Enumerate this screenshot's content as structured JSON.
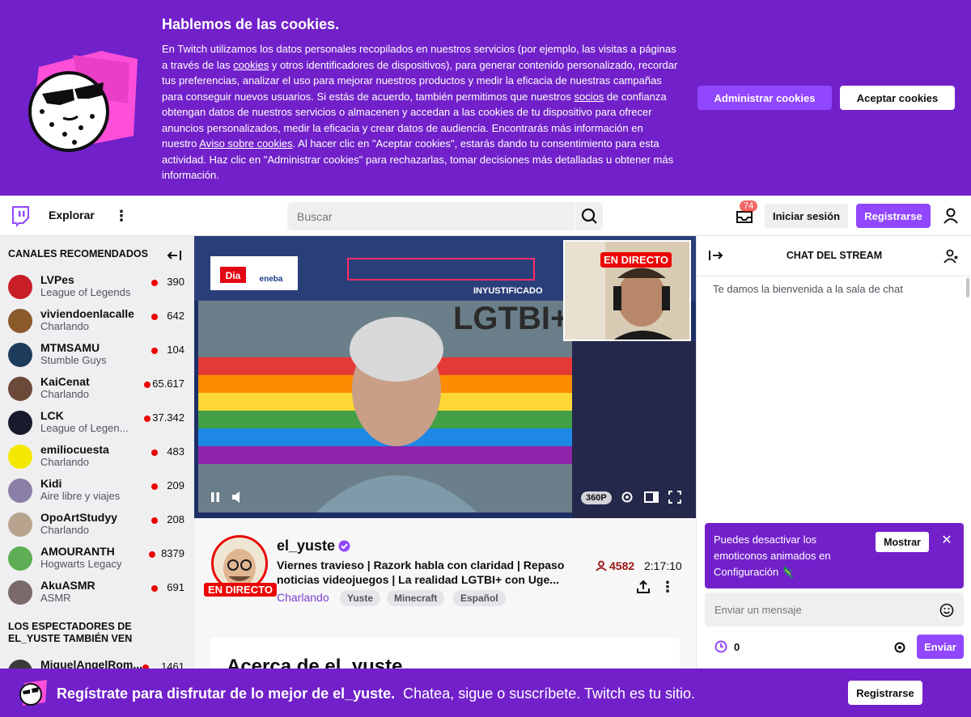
{
  "cookies": {
    "title": "Hablemos de las cookies.",
    "body_1": "En Twitch utilizamos los datos personales recopilados en nuestros servicios (por ejemplo, las visitas a páginas a través de las ",
    "link_cookies": "cookies",
    "body_2": " y otros identificadores de dispositivos), para generar contenido personalizado, recordar tus preferencias, analizar el uso para mejorar nuestros productos y medir la eficacia de nuestras campañas para conseguir nuevos usuarios.   Si estás de acuerdo, también permitimos que nuestros ",
    "link_socios": "socios",
    "body_3": " de confianza obtengan datos de nuestros servicios o almacenen y accedan a las cookies de tu dispositivo para ofrecer anuncios personalizados, medir la eficacia y crear datos de audiencia. Encontrarás más información en nuestro ",
    "link_aviso": "Aviso sobre cookies",
    "body_4": ". Al hacer clic en \"Aceptar cookies\", estarás dando tu consentimiento para esta actividad. Haz clic en \"Administrar cookies\" para rechazarlas, tomar decisiones más detalladas u obtener más información.",
    "manage_label": "Administrar cookies",
    "accept_label": "Aceptar cookies"
  },
  "nav": {
    "explore": "Explorar",
    "more": "⋮",
    "search_placeholder": "Buscar",
    "inbox_badge": "74",
    "login": "Iniciar sesión",
    "signup": "Registrarse"
  },
  "sidebar": {
    "header": "CANALES RECOMENDADOS",
    "channels": [
      {
        "name": "LVPes",
        "game": "League of Legends",
        "viewers": "390",
        "color": "#c81e28"
      },
      {
        "name": "viviendoenlacalle",
        "game": "Charlando",
        "viewers": "642",
        "color": "#8a5a2b"
      },
      {
        "name": "MTMSAMU",
        "game": "Stumble Guys",
        "viewers": "104",
        "color": "#1d3b5a"
      },
      {
        "name": "KaiCenat",
        "game": "Charlando",
        "viewers": "65.617",
        "color": "#6b4a3a"
      },
      {
        "name": "LCK",
        "game": "League of Legen...",
        "viewers": "37.342",
        "color": "#1a1a2e"
      },
      {
        "name": "emiliocuesta",
        "game": "Charlando",
        "viewers": "483",
        "color": "#f5e800"
      },
      {
        "name": "Kidi",
        "game": "Aire libre y viajes",
        "viewers": "209",
        "color": "#8a7fa6"
      },
      {
        "name": "OpoArtStudyy",
        "game": "Charlando",
        "viewers": "208",
        "color": "#b8a48e"
      },
      {
        "name": "AMOURANTH",
        "game": "Hogwarts Legacy",
        "viewers": "8379",
        "color": "#5fae55"
      },
      {
        "name": "AkuASMR",
        "game": "ASMR",
        "viewers": "691",
        "color": "#7a6a6a"
      }
    ],
    "header2": "LOS ESPECTADORES DE EL_YUSTE TAMBIÉN VEN",
    "partial_channel": {
      "name": "MiguelAngelRom...",
      "viewers": "1461"
    }
  },
  "video": {
    "pip_live": "EN DIRECTO",
    "overlay_handle": "INYUSTIFICADO",
    "quality": "360P"
  },
  "stream": {
    "live": "EN DIRECTO",
    "streamer": "el_yuste",
    "title": "Viernes travieso | Razork habla con claridad | Repaso noticias videojuegos | La realidad LGTBI+ con Uge...",
    "category": "Charlando",
    "tags": [
      "Yuste",
      "Minecraft",
      "Español"
    ],
    "viewers": "4582",
    "uptime": "2:17:10",
    "about_title": "Acerca de el_yuste"
  },
  "chat": {
    "title": "CHAT DEL STREAM",
    "welcome": "Te damos la bienvenida a la sala de chat",
    "notice": "Puedes desactivar los emoticonos animados en Configuración",
    "show_label": "Mostrar",
    "input_placeholder": "Enviar un mensaje",
    "points": "0",
    "send_label": "Enviar"
  },
  "bottom": {
    "bold": "Regístrate para disfrutar de lo mejor de el_yuste.",
    "rest": "Chatea, sigue o suscríbete. Twitch es tu sitio.",
    "signup": "Registrarse"
  },
  "colors": {
    "brand_purple": "#9147ff",
    "banner_purple": "#7221ca",
    "live_red": "#eb0400"
  }
}
